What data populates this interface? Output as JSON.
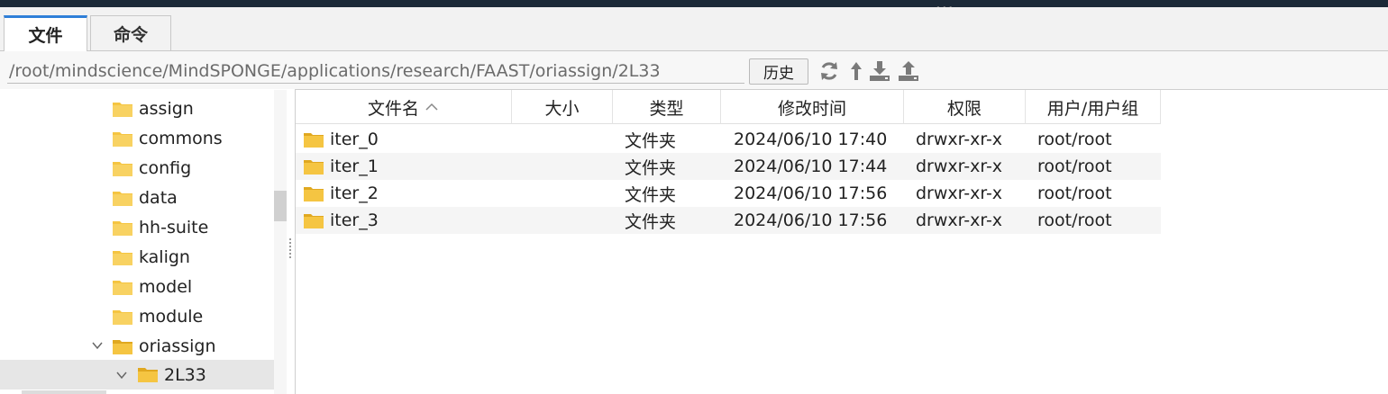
{
  "tabs": [
    {
      "label": "文件",
      "active": true
    },
    {
      "label": "命令",
      "active": false
    }
  ],
  "path": {
    "value": "/root/mindscience/MindSPONGE/applications/research/FAAST/oriassign/2L33",
    "history_label": "历史"
  },
  "toolbar_icons": [
    "refresh-icon",
    "up-arrow-icon",
    "download-icon",
    "upload-icon"
  ],
  "tree": {
    "items": [
      {
        "label": "assign",
        "expanded": false
      },
      {
        "label": "commons",
        "expanded": false
      },
      {
        "label": "config",
        "expanded": false
      },
      {
        "label": "data",
        "expanded": false
      },
      {
        "label": "hh-suite",
        "expanded": false
      },
      {
        "label": "kalign",
        "expanded": false
      },
      {
        "label": "model",
        "expanded": false
      },
      {
        "label": "module",
        "expanded": false
      },
      {
        "label": "oriassign",
        "expanded": true
      },
      {
        "label": "2L33",
        "expanded": true,
        "selected": true
      }
    ]
  },
  "table": {
    "columns": [
      "文件名",
      "大小",
      "类型",
      "修改时间",
      "权限",
      "用户/用户组"
    ],
    "sort_indicator": "^",
    "rows": [
      {
        "name": "iter_0",
        "size": "",
        "type": "文件夹",
        "modified": "2024/06/10 17:40",
        "perm": "drwxr-xr-x",
        "owner": "root/root"
      },
      {
        "name": "iter_1",
        "size": "",
        "type": "文件夹",
        "modified": "2024/06/10 17:44",
        "perm": "drwxr-xr-x",
        "owner": "root/root"
      },
      {
        "name": "iter_2",
        "size": "",
        "type": "文件夹",
        "modified": "2024/06/10 17:56",
        "perm": "drwxr-xr-x",
        "owner": "root/root"
      },
      {
        "name": "iter_3",
        "size": "",
        "type": "文件夹",
        "modified": "2024/06/10 17:56",
        "perm": "drwxr-xr-x",
        "owner": "root/root"
      }
    ]
  },
  "colors": {
    "accent": "#2f7fd8",
    "folder": "#f5c542",
    "folder_dark": "#e0a820",
    "icon_gray": "#7a7a7a"
  }
}
